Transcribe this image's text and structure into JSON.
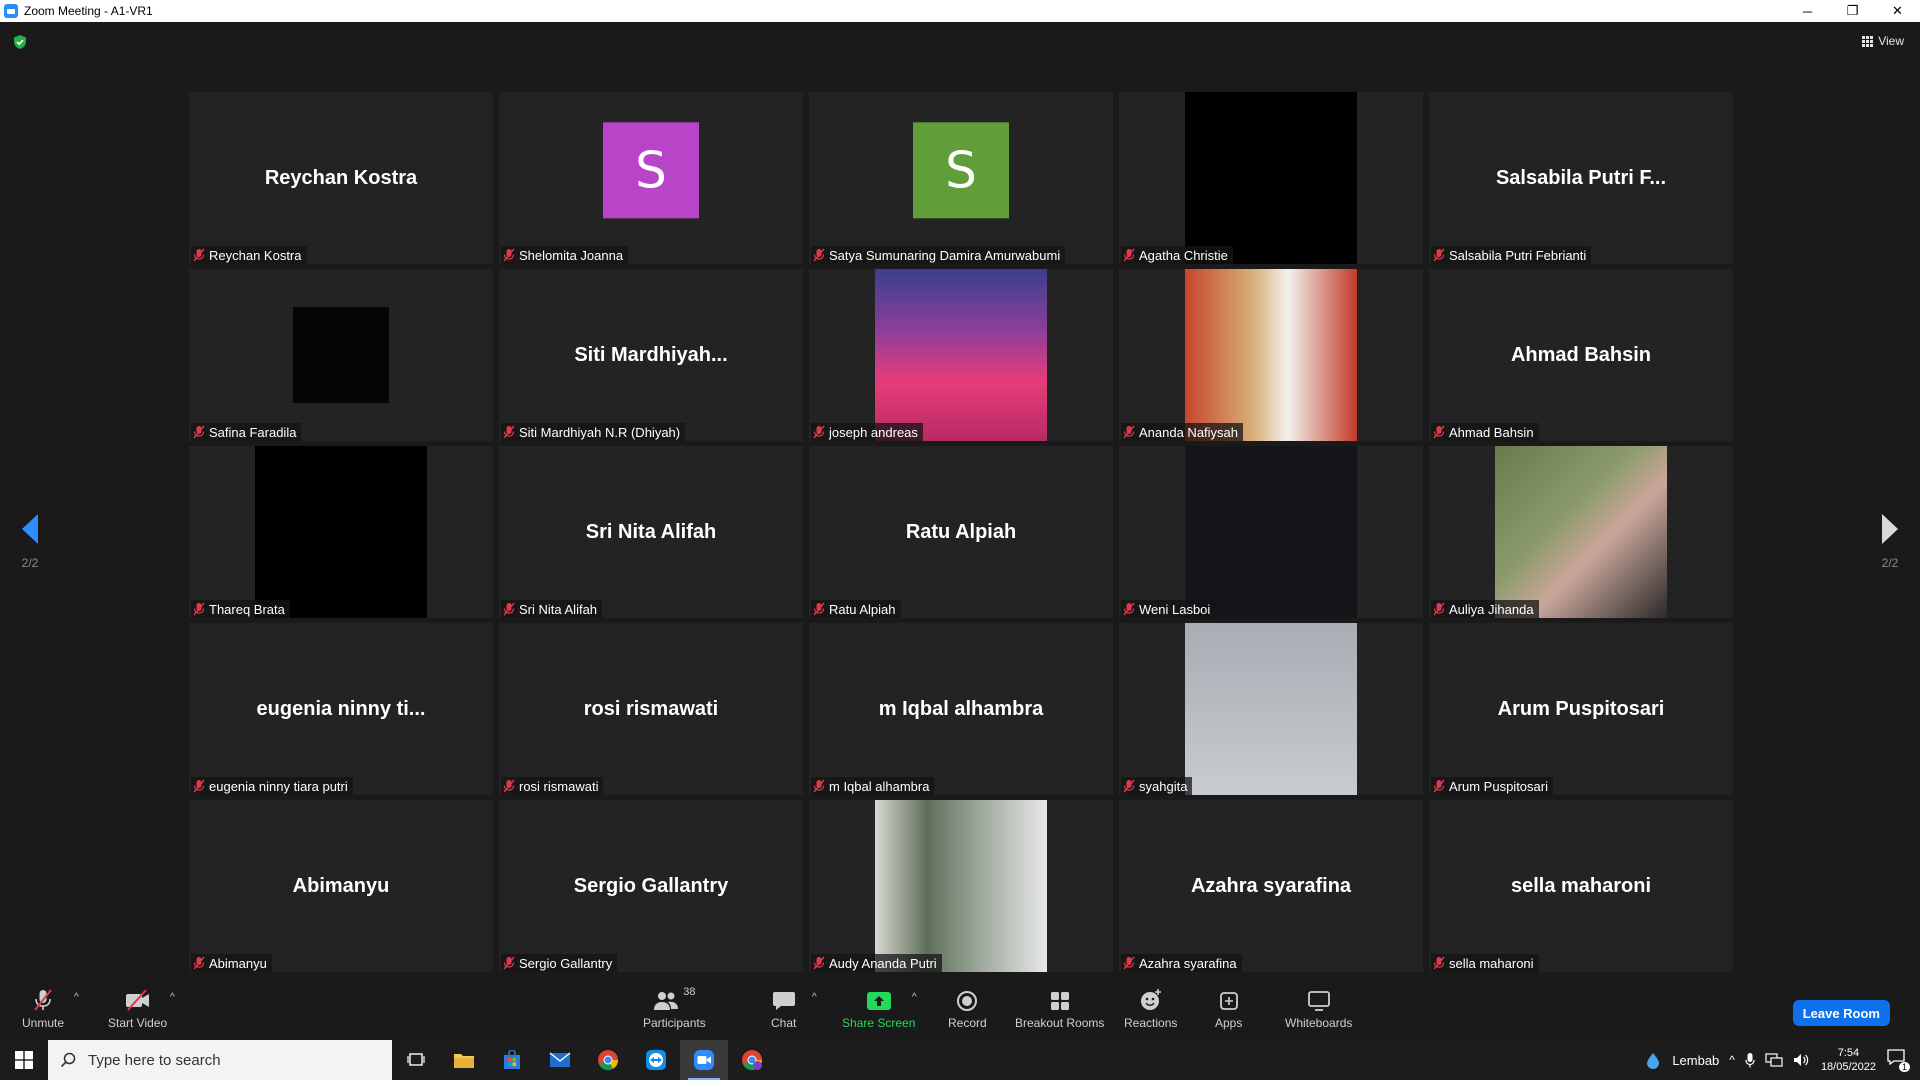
{
  "window": {
    "title": "Zoom Meeting - A1-VR1",
    "minimize": "─",
    "restore": "❐",
    "close": "✕"
  },
  "meeting": {
    "view_label": "View",
    "page_left": "2/2",
    "page_right": "2/2",
    "tiles": [
      {
        "display": "Reychan Kostra",
        "tag": "Reychan Kostra",
        "kind": "name"
      },
      {
        "display": "S",
        "tag": "Shelomita Joanna",
        "kind": "avatar",
        "color": "#b845c7"
      },
      {
        "display": "S",
        "tag": "Satya Sumunaring Damira Amurwabumi",
        "kind": "avatar",
        "color": "#5f9e38"
      },
      {
        "display": "",
        "tag": "Agatha Christie",
        "kind": "video",
        "video": "v-black"
      },
      {
        "display": "Salsabila Putri F...",
        "tag": "Salsabila Putri Febrianti",
        "kind": "name"
      },
      {
        "display": "",
        "tag": "Safina Faradila",
        "kind": "video",
        "video": "v-stars"
      },
      {
        "display": "Siti  Mardhiyah...",
        "tag": "Siti Mardhiyah N.R (Dhiyah)",
        "kind": "name"
      },
      {
        "display": "",
        "tag": "joseph andreas",
        "kind": "video",
        "video": "v-sunset"
      },
      {
        "display": "",
        "tag": "Ananda Nafiysah",
        "kind": "video",
        "video": "v-hijab"
      },
      {
        "display": "Ahmad Bahsin",
        "tag": "Ahmad Bahsin",
        "kind": "name"
      },
      {
        "display": "",
        "tag": "Thareq Brata",
        "kind": "video",
        "video": "v-black"
      },
      {
        "display": "Sri Nita Alifah",
        "tag": "Sri Nita Alifah",
        "kind": "name"
      },
      {
        "display": "Ratu Alpiah",
        "tag": "Ratu Alpiah",
        "kind": "name"
      },
      {
        "display": "",
        "tag": "Weni Lasboi",
        "kind": "video",
        "video": "v-dark"
      },
      {
        "display": "",
        "tag": "Auliya Jihanda",
        "kind": "video",
        "video": "v-grass"
      },
      {
        "display": "eugenia ninny ti...",
        "tag": "eugenia ninny tiara putri",
        "kind": "name"
      },
      {
        "display": "rosi rismawati",
        "tag": "rosi rismawati",
        "kind": "name"
      },
      {
        "display": "m Iqbal alhambra",
        "tag": "m Iqbal alhambra",
        "kind": "name"
      },
      {
        "display": "",
        "tag": "syahgita",
        "kind": "video",
        "video": "v-grey"
      },
      {
        "display": "Arum Puspitosari",
        "tag": "Arum Puspitosari",
        "kind": "name"
      },
      {
        "display": "Abimanyu",
        "tag": "Abimanyu",
        "kind": "name"
      },
      {
        "display": "Sergio Gallantry",
        "tag": "Sergio Gallantry",
        "kind": "name"
      },
      {
        "display": "",
        "tag": "Audy Ananda Putri",
        "kind": "video",
        "video": "v-window"
      },
      {
        "display": "Azahra syarafina",
        "tag": "Azahra syarafina",
        "kind": "name"
      },
      {
        "display": "sella maharoni",
        "tag": "sella maharoni",
        "kind": "name"
      }
    ]
  },
  "toolbar": {
    "unmute": "Unmute",
    "start_video": "Start Video",
    "participants": "Participants",
    "participants_count": "38",
    "chat": "Chat",
    "share_screen": "Share Screen",
    "record": "Record",
    "breakout_rooms": "Breakout Rooms",
    "reactions": "Reactions",
    "apps": "Apps",
    "whiteboards": "Whiteboards",
    "leave_room": "Leave Room"
  },
  "taskbar": {
    "search_placeholder": "Type here to search",
    "weather": "Lembab",
    "time": "7:54",
    "date": "18/05/2022",
    "notification_count": "1"
  },
  "colors": {
    "accent_blue": "#0e71eb",
    "share_green": "#23d959",
    "muted_red": "#e0394a"
  }
}
